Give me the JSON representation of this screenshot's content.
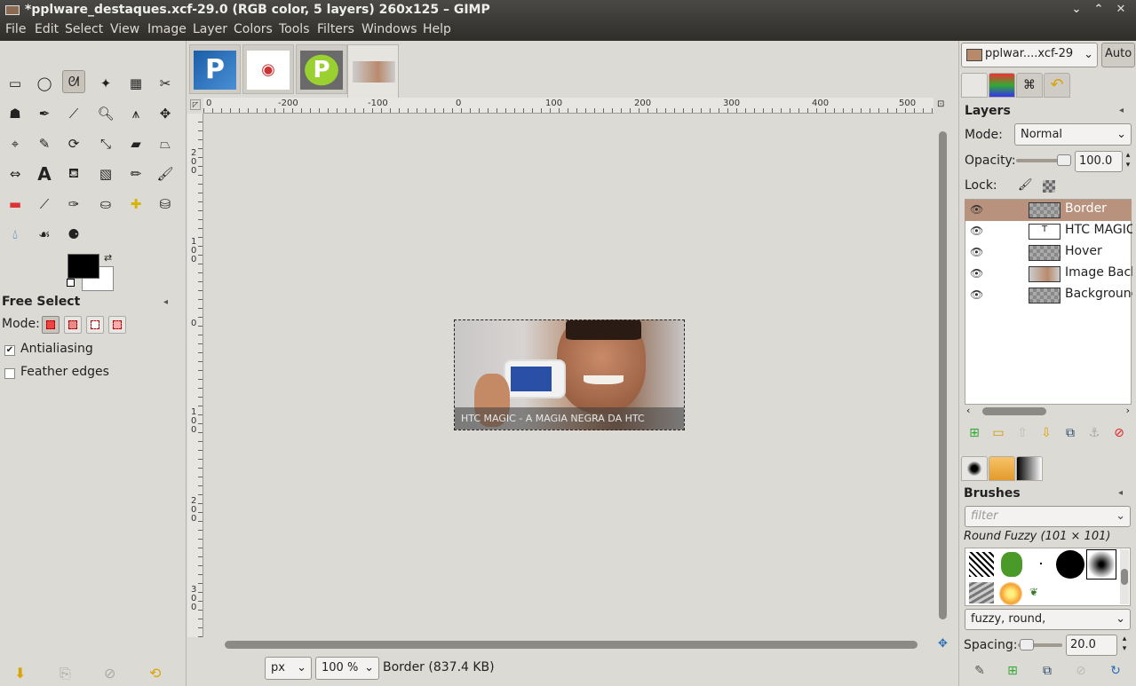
{
  "window": {
    "title": "*pplware_destaques.xcf-29.0 (RGB color, 5 layers) 260x125 – GIMP"
  },
  "menu": [
    "File",
    "Edit",
    "Select",
    "View",
    "Image",
    "Layer",
    "Colors",
    "Tools",
    "Filters",
    "Windows",
    "Help"
  ],
  "tool_options": {
    "title": "Free Select",
    "mode_label": "Mode:",
    "antialiasing_label": "Antialiasing",
    "antialiasing_checked": true,
    "feather_label": "Feather edges",
    "feather_checked": false
  },
  "rulers": {
    "h_ticks": [
      "0",
      "-200",
      "-100",
      "0",
      "100",
      "200",
      "300",
      "400",
      "500"
    ],
    "v_ticks": [
      "2\n0\n0",
      "1\n0\n0",
      "0",
      "1\n0\n0",
      "2\n0\n0",
      "3\n0\n0"
    ]
  },
  "image": {
    "caption": "HTC MAGIC - A MAGIA NEGRA DA HTC"
  },
  "status": {
    "unit": "px",
    "zoom": "100 %",
    "info": "Border (837.4 KB)"
  },
  "dock": {
    "image_selector": "pplwar....xcf-29",
    "auto_label": "Auto",
    "layers": {
      "title": "Layers",
      "mode_label": "Mode:",
      "mode_value": "Normal",
      "opacity_label": "Opacity:",
      "opacity_value": "100.0",
      "opacity_fraction": 1.0,
      "lock_label": "Lock:",
      "items": [
        "Border",
        "HTC MAGIC",
        "Hover",
        "Image Back",
        "Background"
      ],
      "selected": "Border"
    },
    "brushes": {
      "title": "Brushes",
      "filter_placeholder": "filter",
      "current": "Round Fuzzy (101 × 101)",
      "tags": "fuzzy, round,",
      "spacing_label": "Spacing:",
      "spacing_value": "20.0"
    }
  }
}
